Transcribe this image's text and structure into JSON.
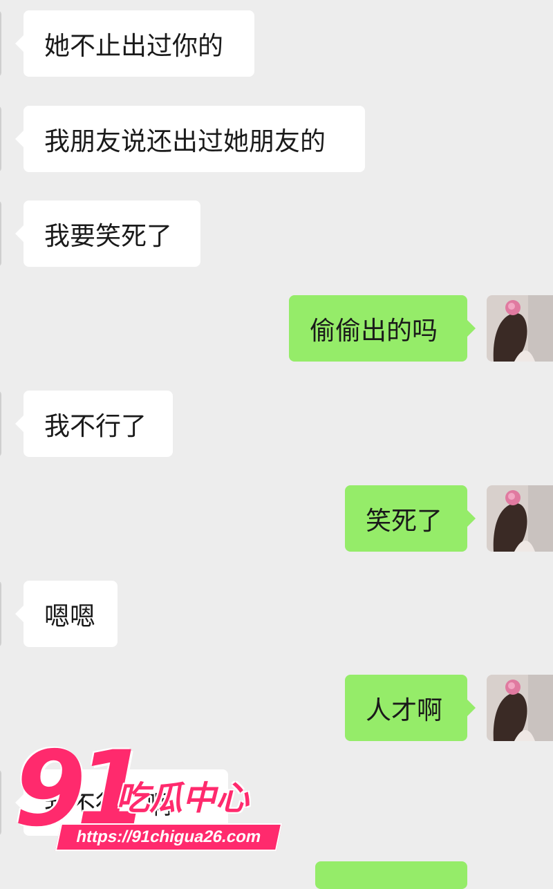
{
  "messages": [
    {
      "side": "in",
      "text": "她不止出过你的"
    },
    {
      "side": "in",
      "text": "我朋友说还出过她朋友的"
    },
    {
      "side": "in",
      "text": "我要笑死了"
    },
    {
      "side": "out",
      "text": "偷偷出的吗"
    },
    {
      "side": "in",
      "text": "我不行了"
    },
    {
      "side": "out",
      "text": "笑死了"
    },
    {
      "side": "in",
      "text": "嗯嗯"
    },
    {
      "side": "out",
      "text": "人才啊"
    },
    {
      "side": "in",
      "text": "我不行了啊"
    }
  ],
  "watermark": {
    "number": "91",
    "title": "吃瓜中心",
    "url": "https://91chigua26.com"
  },
  "colors": {
    "background": "#ededed",
    "incoming_bubble": "#ffffff",
    "outgoing_bubble": "#95ec69",
    "watermark": "#ff2a6d"
  }
}
